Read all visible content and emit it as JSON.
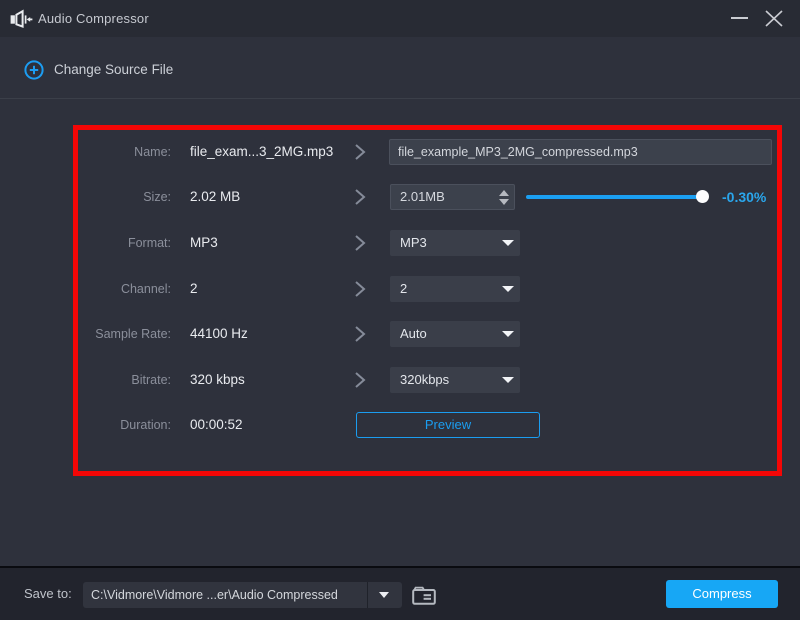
{
  "window": {
    "title": "Audio Compressor"
  },
  "header": {
    "change_source_label": "Change Source File"
  },
  "form": {
    "rows": [
      {
        "label": "Name:",
        "value": "file_exam...3_2MG.mp3"
      },
      {
        "label": "Size:",
        "value": "2.02 MB"
      },
      {
        "label": "Format:",
        "value": "MP3"
      },
      {
        "label": "Channel:",
        "value": "2"
      },
      {
        "label": "Sample Rate:",
        "value": "44100 Hz"
      },
      {
        "label": "Bitrate:",
        "value": "320 kbps"
      },
      {
        "label": "Duration:",
        "value": "00:00:52"
      }
    ],
    "name_input_value": "file_example_MP3_2MG_compressed.mp3",
    "size_spinner_value": "2.01MB",
    "size_slider_percent": 97,
    "size_delta": "-0.30%",
    "format_select_value": "MP3",
    "channel_select_value": "2",
    "samplerate_select_value": "Auto",
    "bitrate_select_value": "320kbps",
    "preview_button_label": "Preview"
  },
  "footer": {
    "save_to_label": "Save to:",
    "save_path": "C:\\Vidmore\\Vidmore ...er\\Audio Compressed",
    "compress_button_label": "Compress"
  },
  "colors": {
    "accent_blue": "#1b9df0",
    "annotation_red": "#f40606",
    "background": "#2e313c",
    "titlebar": "#282b34",
    "bottombar": "#22242d"
  }
}
